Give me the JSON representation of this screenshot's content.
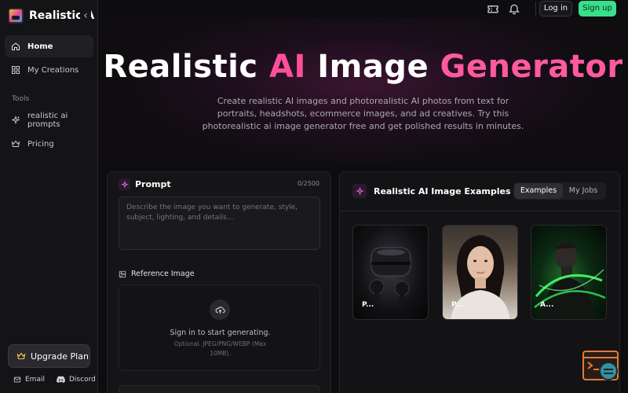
{
  "app": {
    "name": "Realistic AI Image Generator"
  },
  "sidebar": {
    "items": [
      {
        "label": "Home",
        "icon": "home-icon"
      },
      {
        "label": "My Creations",
        "icon": "grid-icon"
      }
    ],
    "tools_label": "Tools",
    "tools": [
      {
        "label": "realistic ai prompts",
        "icon": "sparkle-icon"
      },
      {
        "label": "Pricing",
        "icon": "crown-icon"
      }
    ],
    "upgrade_label": "Upgrade Plan",
    "footer": {
      "email": "Email",
      "discord": "Discord"
    }
  },
  "topbar": {
    "login_label": "Log in",
    "signup_label": "Sign up"
  },
  "hero": {
    "title_part1": "Realistic ",
    "title_ai": "AI",
    "title_part2": " Image ",
    "title_generator": "Generator",
    "subtitle": "Create realistic AI images and photorealistic AI photos from text for portraits, headshots, ecommerce images, and ad creatives. Try this photorealistic ai image generator free and get polished results in minutes."
  },
  "prompt": {
    "title": "Prompt",
    "count": "0/2500",
    "placeholder": "Describe the image you want to generate, style, subject, lighting, and details...",
    "reference_label": "Reference Image",
    "upload_title": "Sign in to start generating.",
    "upload_hint": "Optional. JPEG/PNG/WEBP (Max 10MB)."
  },
  "examples": {
    "title": "Realistic AI Image Examples",
    "tabs": [
      "Examples",
      "My Jobs"
    ],
    "cards": [
      {
        "label": "P..."
      },
      {
        "label": "P..."
      },
      {
        "label": "A..."
      }
    ]
  },
  "colors": {
    "accent_pink": "#ff4f9a",
    "signup_green": "#38e08a"
  }
}
